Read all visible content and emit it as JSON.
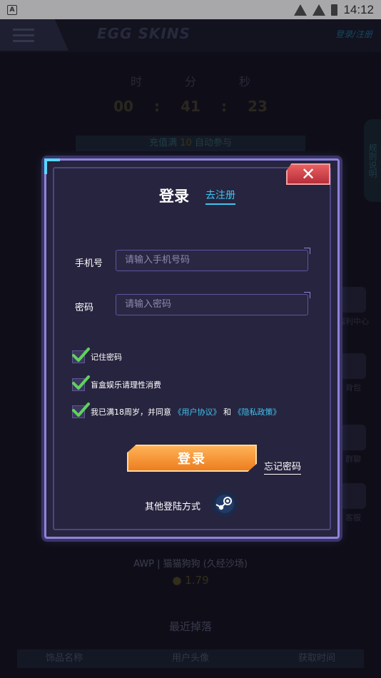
{
  "status_bar": {
    "time": "14:12",
    "app_badge": "A"
  },
  "background": {
    "logo": "EGG SKINS",
    "login_link": "登录/注册",
    "timer_labels": [
      "时",
      "分",
      "秒"
    ],
    "timer_values": [
      "00",
      "41",
      "23"
    ],
    "timer_sep": ":",
    "banner_prefix": "充值满",
    "banner_amount": "10",
    "banner_suffix": "自动参与",
    "rules_tab": "规则说明",
    "side_items": [
      "福利中心",
      "背包",
      "群聊",
      "客服"
    ],
    "item_name": "AWP | 猫猫狗狗 (久经沙场)",
    "item_price": "1.79",
    "recent_title": "最近掉落",
    "table_headers": [
      "饰品名称",
      "用户头像",
      "获取时间"
    ]
  },
  "modal": {
    "close_symbol": "✕",
    "title": "登录",
    "register_link": "去注册",
    "phone_label": "手机号",
    "phone_placeholder": "请输入手机号码",
    "password_label": "密码",
    "password_placeholder": "请输入密码",
    "remember": "记住密码",
    "rational": "盲盒娱乐请理性消费",
    "agree_prefix": "我已满18周岁，并同意",
    "user_agreement": "《用户协议》",
    "agree_and": "和",
    "privacy_policy": "《隐私政策》",
    "login_button": "登录",
    "forgot_password": "忘记密码",
    "other_login": "其他登陆方式"
  }
}
